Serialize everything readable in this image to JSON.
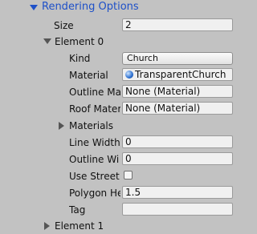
{
  "header": {
    "label": "Rendering Options"
  },
  "size": {
    "label": "Size",
    "value": "2"
  },
  "element0": {
    "label": "Element 0",
    "kind": {
      "label": "Kind",
      "value": "Church"
    },
    "material": {
      "label": "Material",
      "value": "TransparentChurch"
    },
    "outline_material": {
      "label": "Outline Ma",
      "value": "None (Material)"
    },
    "roof_material": {
      "label": "Roof Mater",
      "value": "None (Material)"
    },
    "materials": {
      "label": "Materials"
    },
    "line_width": {
      "label": "Line Width",
      "value": "0"
    },
    "outline_width": {
      "label": "Outline Wi",
      "value": "0"
    },
    "use_street": {
      "label": "Use Street",
      "checked": false
    },
    "polygon_height": {
      "label": "Polygon He",
      "value": "1.5"
    },
    "tag": {
      "label": "Tag",
      "value": ""
    }
  },
  "element1": {
    "label": "Element 1"
  }
}
